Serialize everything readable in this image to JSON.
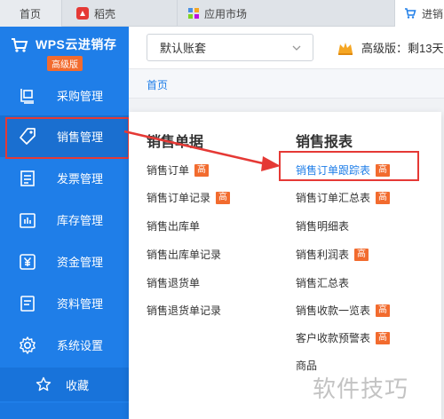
{
  "tabs": [
    {
      "label": "首页"
    },
    {
      "label": "稻壳"
    },
    {
      "label": "应用市场"
    },
    {
      "label": "进销"
    }
  ],
  "sidebar": {
    "app_title": "WPS云进销存",
    "edition_badge": "高级版",
    "items": [
      {
        "label": "采购管理",
        "icon": "purchase-icon"
      },
      {
        "label": "销售管理",
        "icon": "tag-icon",
        "active": true
      },
      {
        "label": "发票管理",
        "icon": "invoice-icon"
      },
      {
        "label": "库存管理",
        "icon": "inventory-icon"
      },
      {
        "label": "资金管理",
        "icon": "yuan-icon"
      },
      {
        "label": "资料管理",
        "icon": "document-icon"
      },
      {
        "label": "系统设置",
        "icon": "gear-icon"
      }
    ],
    "favorites": "收藏"
  },
  "header": {
    "account": "默认账套",
    "version_text": "高级版：剩13天"
  },
  "breadcrumb": "首页",
  "popup": {
    "left_column": {
      "title": "销售单据",
      "items": [
        {
          "label": "销售订单",
          "high": true
        },
        {
          "label": "销售订单记录",
          "high": true
        },
        {
          "label": "销售出库单",
          "high": false
        },
        {
          "label": "销售出库单记录",
          "high": false
        },
        {
          "label": "销售退货单",
          "high": false
        },
        {
          "label": "销售退货单记录",
          "high": false
        }
      ]
    },
    "right_column": {
      "title": "销售报表",
      "items": [
        {
          "label": "销售订单跟踪表",
          "high": true,
          "highlighted": true
        },
        {
          "label": "销售订单汇总表",
          "high": true
        },
        {
          "label": "销售明细表",
          "high": false
        },
        {
          "label": "销售利润表",
          "high": true
        },
        {
          "label": "销售汇总表",
          "high": false
        },
        {
          "label": "销售收款一览表",
          "high": true
        },
        {
          "label": "客户收款预警表",
          "high": true
        },
        {
          "label": "商品",
          "high": false
        }
      ]
    },
    "high_tag": "高"
  },
  "watermark": "软件技巧",
  "colors": {
    "sidebar_blue": "#1f7ee8",
    "badge_orange": "#f26b2e",
    "highlight_red": "#e53935"
  }
}
